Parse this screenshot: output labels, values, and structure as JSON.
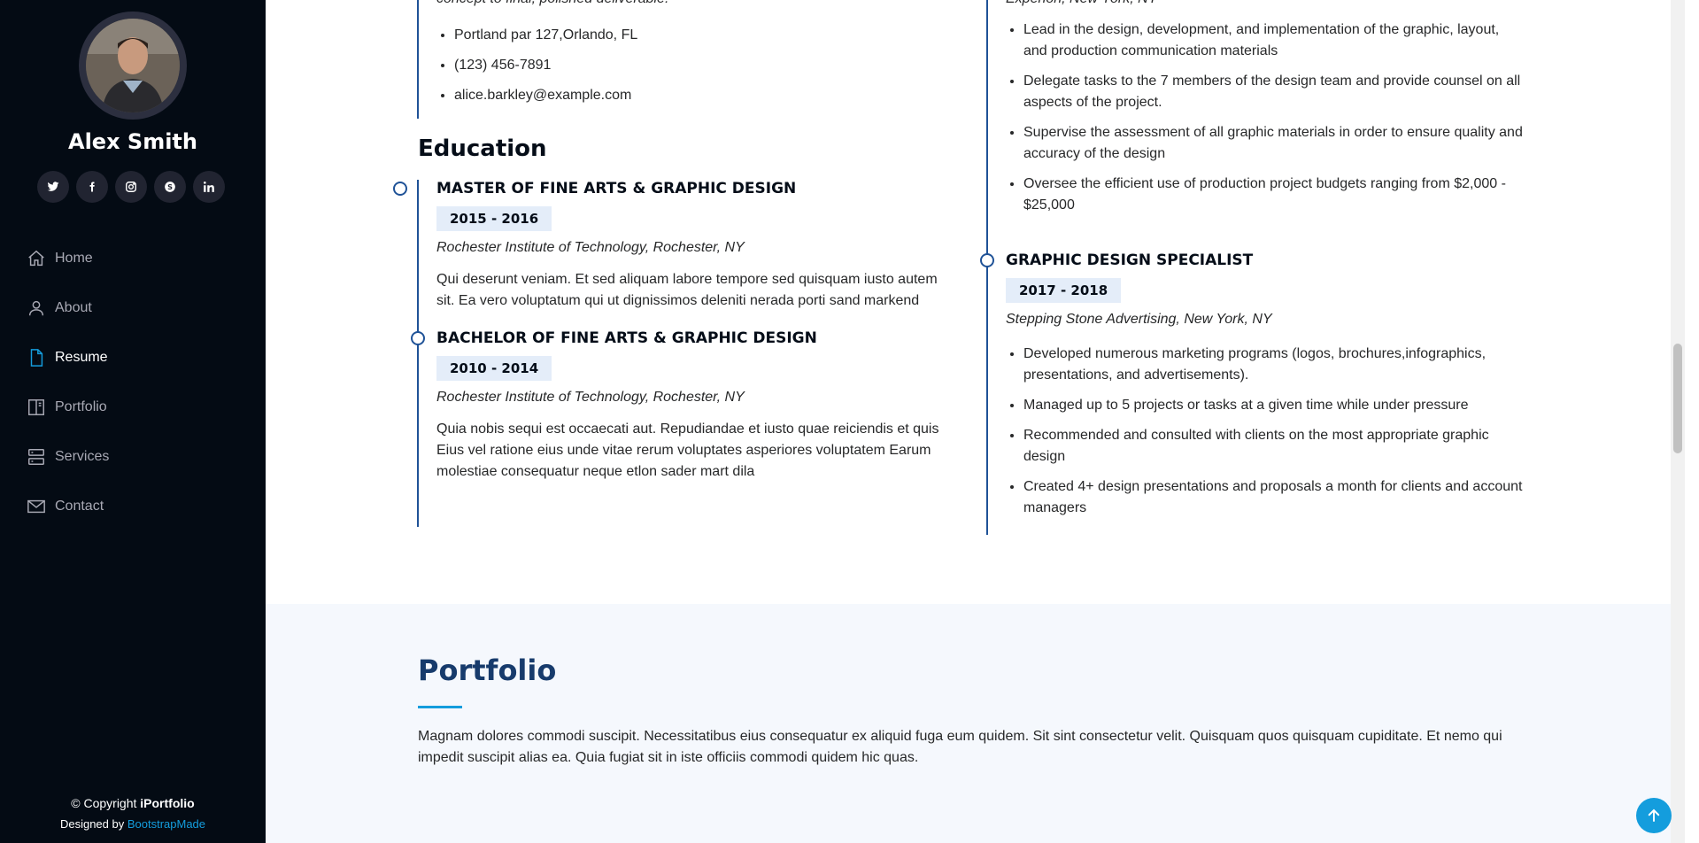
{
  "sidebar": {
    "name": "Alex Smith",
    "socials": [
      {
        "icon": "twitter-icon",
        "glyph": "t"
      },
      {
        "icon": "facebook-icon",
        "glyph": "f"
      },
      {
        "icon": "instagram-icon",
        "glyph": "◎"
      },
      {
        "icon": "skype-icon",
        "glyph": "S"
      },
      {
        "icon": "linkedin-icon",
        "glyph": "in"
      }
    ],
    "nav": [
      {
        "label": "Home",
        "icon": "home-icon"
      },
      {
        "label": "About",
        "icon": "person-icon"
      },
      {
        "label": "Resume",
        "icon": "file-icon"
      },
      {
        "label": "Portfolio",
        "icon": "book-icon"
      },
      {
        "label": "Services",
        "icon": "server-icon"
      },
      {
        "label": "Contact",
        "icon": "envelope-icon"
      }
    ],
    "active_nav": "Resume",
    "copyright_prefix": "© Copyright ",
    "copyright_brand": "iPortfolio",
    "designed_by": "Designed by ",
    "designed_link": "BootstrapMade"
  },
  "summary": {
    "tail": "concept to final, polished deliverable.",
    "contacts": [
      "Portland par 127,Orlando, FL",
      "(123) 456-7891",
      "alice.barkley@example.com"
    ]
  },
  "education": {
    "heading": "Education",
    "items": [
      {
        "title": "Master of Fine Arts & Graphic Design",
        "years": "2015 - 2016",
        "place": "Rochester Institute of Technology, Rochester, NY",
        "text": "Qui deserunt veniam. Et sed aliquam labore tempore sed quisquam iusto autem sit. Ea vero voluptatum qui ut dignissimos deleniti nerada porti sand markend"
      },
      {
        "title": "Bachelor of Fine Arts & Graphic Design",
        "years": "2010 - 2014",
        "place": "Rochester Institute of Technology, Rochester, NY",
        "text": "Quia nobis sequi est occaecati aut. Repudiandae et iusto quae reiciendis et quis Eius vel ratione eius unde vitae rerum voluptates asperiores voluptatem Earum molestiae consequatur neque etlon sader mart dila"
      }
    ]
  },
  "experience": {
    "top_place": "Experion, New York, NY",
    "top_bullets": [
      "Lead in the design, development, and implementation of the graphic, layout, and production communication materials",
      "Delegate tasks to the 7 members of the design team and provide counsel on all aspects of the project.",
      "Supervise the assessment of all graphic materials in order to ensure quality and accuracy of the design",
      "Oversee the efficient use of production project budgets ranging from $2,000 - $25,000"
    ],
    "item": {
      "title": "Graphic design specialist",
      "years": "2017 - 2018",
      "place": "Stepping Stone Advertising, New York, NY",
      "bullets": [
        "Developed numerous marketing programs (logos, brochures,infographics, presentations, and advertisements).",
        "Managed up to 5 projects or tasks at a given time while under pressure",
        "Recommended and consulted with clients on the most appropriate graphic design",
        "Created 4+ design presentations and proposals a month for clients and account managers"
      ]
    }
  },
  "portfolio": {
    "title": "Portfolio",
    "description": "Magnam dolores commodi suscipit. Necessitatibus eius consequatur ex aliquid fuga eum quidem. Sit sint consectetur velit. Quisquam quos quisquam cupiditate. Et nemo qui impedit suscipit alias ea. Quia fugiat sit in iste officiis commodi quidem hic quas."
  },
  "colors": {
    "sidebar_bg": "#040b14",
    "accent": "#149ddd",
    "timeline": "#1f5297",
    "portfolio_bg": "#f5f8fd"
  }
}
